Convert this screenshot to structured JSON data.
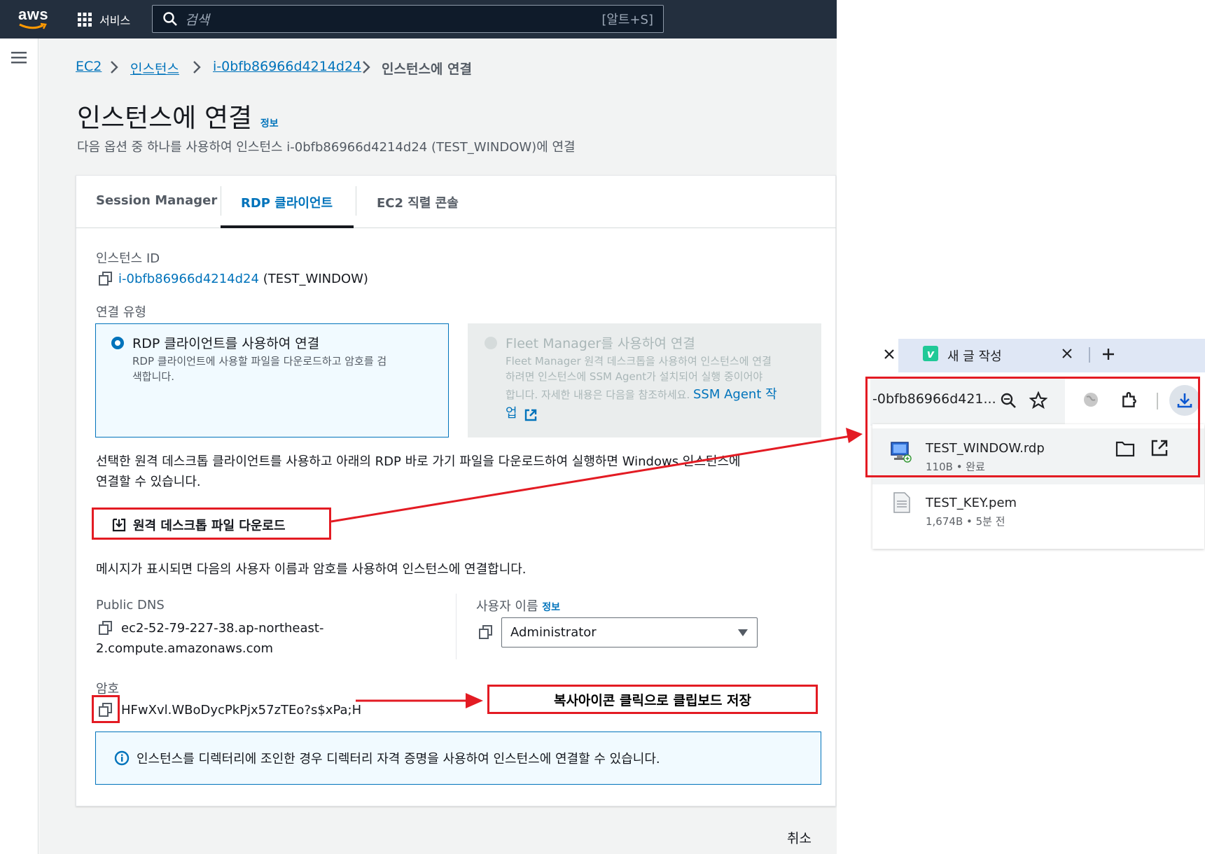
{
  "topbar": {
    "logo_text": "aws",
    "services_label": "서비스",
    "search_placeholder": "검색",
    "search_shortcut": "[알트+S]"
  },
  "breadcrumb": {
    "items": [
      "EC2",
      "인스턴스",
      "i-0bfb86966d4214d24"
    ],
    "current": "인스턴스에 연결"
  },
  "page": {
    "title": "인스턴스에 연결",
    "info_label": "정보",
    "subtitle": "다음 옵션 중 하나를 사용하여 인스턴스 i-0bfb86966d4214d24 (TEST_WINDOW)에 연결"
  },
  "tabs": [
    {
      "label": "Session Manager",
      "active": false
    },
    {
      "label": "RDP 클라이언트",
      "active": true
    },
    {
      "label": "EC2 직렬 콘솔",
      "active": false
    }
  ],
  "instance": {
    "label": "인스턴스 ID",
    "id": "i-0bfb86966d4214d24",
    "name": "(TEST_WINDOW)"
  },
  "connection_type": {
    "label": "연결 유형",
    "options": [
      {
        "title": "RDP 클라이언트를 사용하여 연결",
        "desc1": "RDP 클라이언트에 사용할 파일을 다운로드하고 암호를 검",
        "desc2": "색합니다.",
        "selected": true
      },
      {
        "title": "Fleet Manager를 사용하여 연결",
        "desc1": "Fleet Manager 원격 데스크톱을 사용하여 인스턴스에 연결",
        "desc2": "하려면 인스턴스에 SSM Agent가 설치되어 실행 중이어야",
        "desc3": "합니다. 자세한 내용은 다음을 참조하세요.",
        "link": "SSM Agent 작",
        "link2": "업",
        "selected": false
      }
    ]
  },
  "instructions": {
    "line1": "선택한 원격 데스크톱 클라이언트를 사용하고 아래의 RDP 바로 가기 파일을 다운로드하여 실행하면 Windows 인스턴스에",
    "line2": "연결할 수 있습니다.",
    "download_label": "원격 데스크톱 파일 다운로드",
    "prompt_text": "메시지가 표시되면 다음의 사용자 이름과 암호를 사용하여 인스턴스에 연결합니다."
  },
  "public_dns": {
    "label": "Public DNS",
    "value_line1": "ec2-52-79-227-38.ap-northeast-",
    "value_line2": "2.compute.amazonaws.com"
  },
  "username": {
    "label": "사용자 이름",
    "info_label": "정보",
    "selected": "Administrator"
  },
  "password": {
    "label": "암호",
    "value": "HFwXvl.WBoDycPkPjx57zTEo?s$xPa;H"
  },
  "alert": {
    "text": "인스턴스를 디렉터리에 조인한 경우 디렉터리 자격 증명을 사용하여 인스턴스에 연결할 수 있습니다."
  },
  "footer": {
    "cancel_label": "취소"
  },
  "annotation": {
    "copy_note": "복사아이콘 클릭으로 클립보드 저장"
  },
  "browser": {
    "tab_title": "새 글 작성",
    "tab_icon_letter": "v",
    "url_fragment": "-0bfb86966d421...",
    "downloads": [
      {
        "name": "TEST_WINDOW.rdp",
        "meta": "110B • 완료"
      },
      {
        "name": "TEST_KEY.pem",
        "meta": "1,674B • 5분 전"
      }
    ]
  },
  "colors": {
    "topbar": "#232f3e",
    "link": "#0073bb",
    "annotation_red": "#e31b23"
  }
}
